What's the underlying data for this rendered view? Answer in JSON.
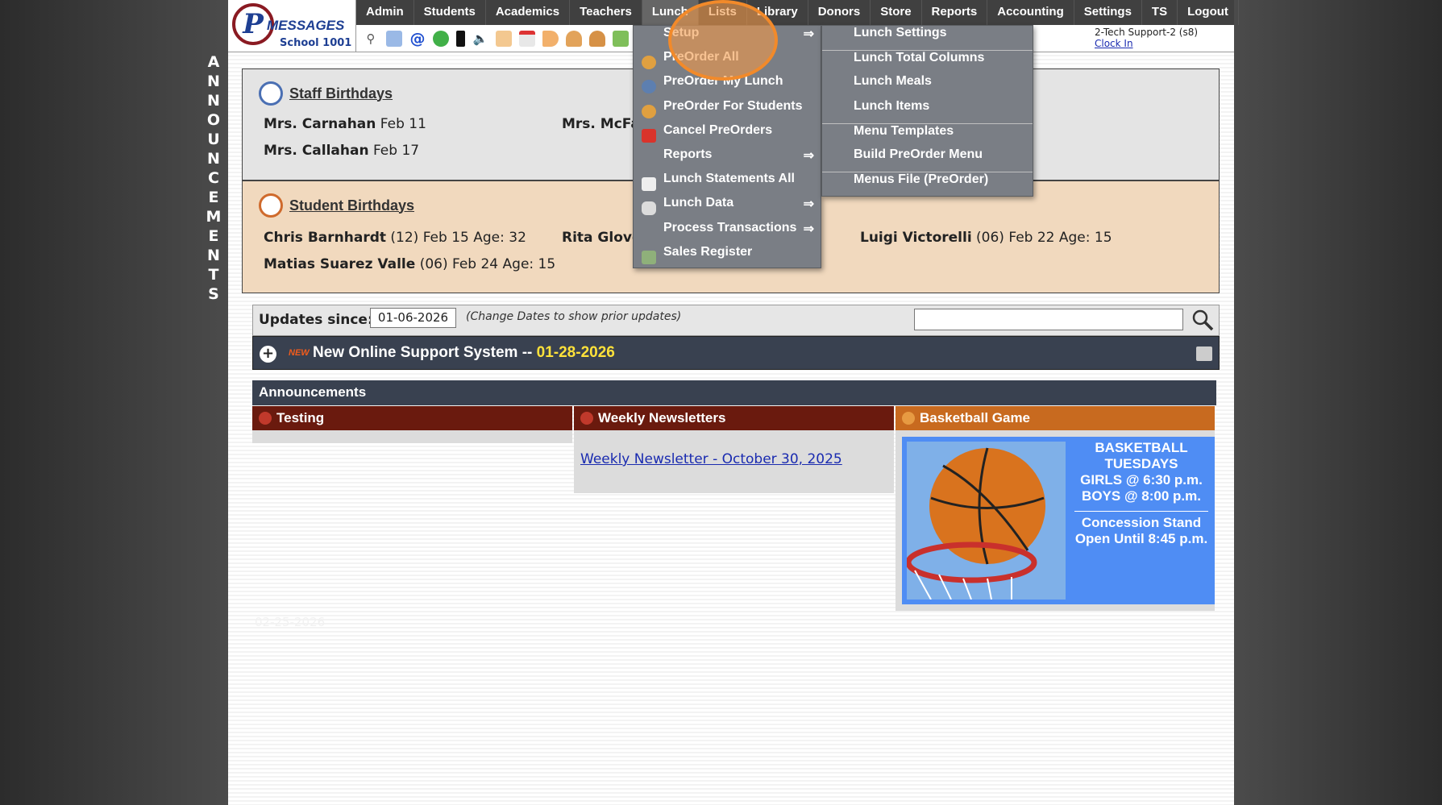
{
  "vertical_banner": [
    "A",
    "N",
    "N",
    "O",
    "U",
    "N",
    "C",
    "E",
    "M",
    "E",
    "N",
    "T",
    "S"
  ],
  "logo": {
    "letter": "P",
    "brand": "MESSAGES",
    "school": "School 1001"
  },
  "nav": [
    "Admin",
    "Students",
    "Academics",
    "Teachers",
    "Lunch",
    "Lists",
    "Library",
    "Donors",
    "Store",
    "Reports",
    "Accounting",
    "Settings",
    "TS",
    "Logout"
  ],
  "toolbar_icons": [
    "search-icon",
    "grid-icon",
    "at-icon",
    "chat-icon",
    "phone-icon",
    "speaker-icon",
    "newsletter-icon",
    "calendar-icon",
    "megaphone-icon",
    "person-icon",
    "person-alt-icon",
    "book-icon"
  ],
  "user": {
    "name": "2-Tech Support-2 (s8)",
    "clock": "Clock In"
  },
  "staff": {
    "title": "Staff Birthdays",
    "entries": [
      {
        "name": "Mrs. Carnahan",
        "date": "Feb 11"
      },
      {
        "name": "Mrs. McFa",
        "date": ""
      },
      {
        "name": "Mrs. Callahan",
        "date": "Feb 17"
      }
    ]
  },
  "students": {
    "title": "Student Birthdays",
    "entries": [
      {
        "name": "Chris Barnhardt",
        "detail": "(12) Feb 15 Age: 32"
      },
      {
        "name": "Rita Glove",
        "detail": ""
      },
      {
        "name": "Luigi Victorelli",
        "detail": "(06) Feb 22 Age: 15"
      },
      {
        "name": "Matias Suarez Valle",
        "detail": "(06) Feb 24 Age: 15"
      }
    ]
  },
  "updates": {
    "label": "Updates since:",
    "date": "01-06-2026",
    "hint": "(Change Dates to show prior updates)",
    "search_value": ""
  },
  "support": {
    "badge": "NEW",
    "title": "New Online Support System -- ",
    "date": "01-28-2026"
  },
  "announcements": {
    "header": "Announcements",
    "columns": [
      {
        "title": "Testing"
      },
      {
        "title": "Weekly Newsletters",
        "link": "Weekly Newsletter - October 30, 2025"
      },
      {
        "title": "Basketball Game",
        "lines": [
          "BASKETBALL",
          "TUESDAYS",
          "GIRLS @ 6:30 p.m.",
          "BOYS  @ 8:00 p.m.",
          "Concession Stand",
          "Open Until 8:45 p.m."
        ]
      }
    ]
  },
  "ghost_text": "02-25-2026",
  "lunch_menu": [
    {
      "label": "Setup",
      "submenu": true
    },
    {
      "label": "PreOrder All"
    },
    {
      "label": "PreOrder My Lunch"
    },
    {
      "label": "PreOrder For Students"
    },
    {
      "label": "Cancel PreOrders"
    },
    {
      "label": "Reports",
      "submenu": true
    },
    {
      "label": "Lunch Statements All"
    },
    {
      "label": "Lunch Data",
      "submenu": true
    },
    {
      "label": "Process Transactions",
      "submenu": true
    },
    {
      "label": "Sales Register"
    }
  ],
  "setup_menu": [
    "Lunch Settings",
    "Lunch Total Columns",
    "Lunch Meals",
    "Lunch Items",
    "Menu Templates",
    "Build PreOrder Menu",
    "Menus File (PreOrder)"
  ],
  "arrow_glyph": "⇒",
  "colors": {
    "nav_bg": "#404040",
    "testing": "#6a1a0e",
    "newsletters": "#6a1a0e",
    "basketball": "#c86a1f",
    "highlight": "#f28a2a"
  }
}
